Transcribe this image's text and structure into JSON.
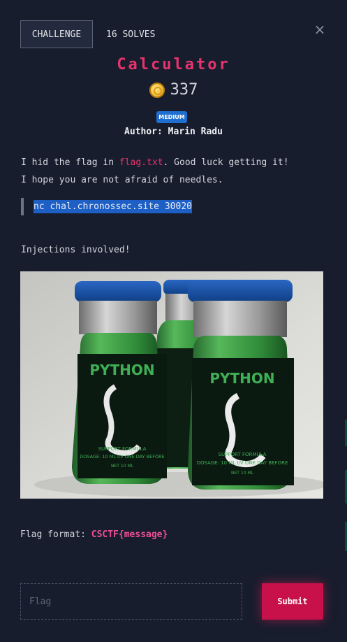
{
  "tabs": {
    "challenge": "CHALLENGE",
    "solves": "16 SOLVES"
  },
  "close_icon": "×",
  "challenge": {
    "title": "Calculator",
    "points": "337",
    "difficulty": "MEDIUM",
    "author": "Author: Marin Radu"
  },
  "description": {
    "line1_before": "I hid the flag in ",
    "line1_highlight": "flag.txt",
    "line1_after": ". Good luck getting it!",
    "line2": "I hope you are not afraid of needles.",
    "command": "nc chal.chronossec.site 30020",
    "note": "Injections involved!"
  },
  "image": {
    "bottle_label": "PYTHON",
    "bottle_small_text": "SUPPORT FORMULA",
    "bottle_dosage": "DOSAGE: 10 ML I/V ONE DAY BEFORE",
    "bottle_net": "NET 10 ML"
  },
  "flag": {
    "format_label": "Flag format: ",
    "format_value": "CSCTF{message}",
    "placeholder": "Flag",
    "submit_label": "Submit"
  },
  "colors": {
    "background": "#181d2d",
    "accent": "#e8336f",
    "badge": "#1f6fd1",
    "submit": "#c8104a"
  },
  "icons": {
    "coin": "coin-icon",
    "close": "close-icon"
  }
}
